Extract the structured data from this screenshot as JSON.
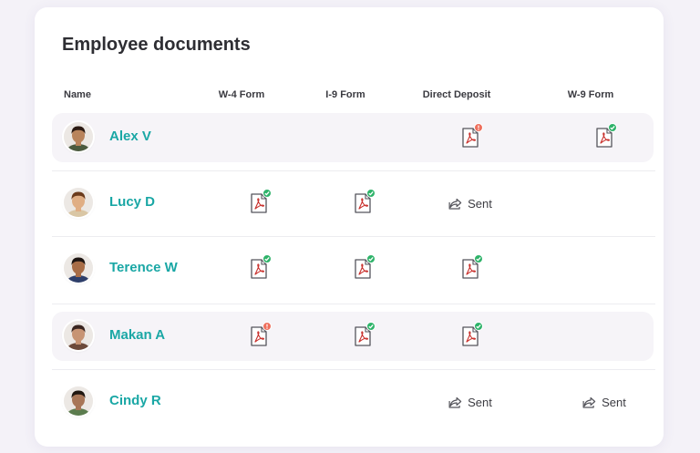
{
  "title": "Employee documents",
  "columns": {
    "name": "Name",
    "w4": "W-4 Form",
    "i9": "I-9 Form",
    "deposit": "Direct Deposit",
    "w9": "W-9 Form"
  },
  "employees": [
    {
      "name": "Alex V",
      "w4": "",
      "i9": "",
      "deposit": "pdf-warning",
      "w9": "pdf-complete"
    },
    {
      "name": "Lucy D",
      "w4": "pdf-complete",
      "i9": "pdf-complete",
      "deposit": "Sent",
      "w9": ""
    },
    {
      "name": "Terence W",
      "w4": "pdf-complete",
      "i9": "pdf-complete",
      "deposit": "pdf-complete",
      "w9": ""
    },
    {
      "name": "Makan A",
      "w4": "pdf-warning",
      "i9": "pdf-complete",
      "deposit": "pdf-complete",
      "w9": ""
    },
    {
      "name": "Cindy R",
      "w4": "",
      "i9": "",
      "deposit": "Sent",
      "w9": "Sent"
    }
  ],
  "colors": {
    "accent": "#1aa7a5",
    "complete": "#2fb36a",
    "warning": "#ee6f5d",
    "pdf": "#c9302c",
    "row_highlight": "#f6f4f8"
  },
  "icons": {
    "document": "pdf-file-icon",
    "complete": "check-badge-icon",
    "warning": "alert-badge-icon",
    "sent": "share-arrow-icon"
  }
}
